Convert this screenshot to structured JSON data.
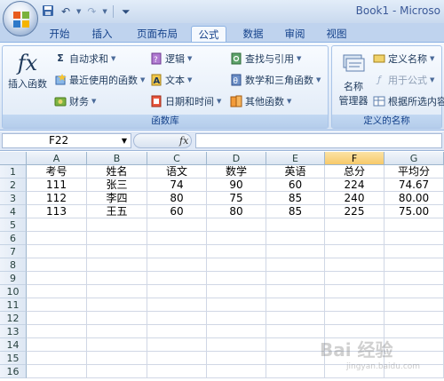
{
  "window": {
    "title": "Book1 - Microso"
  },
  "quick_access": [
    "save-icon",
    "undo-icon",
    "redo-icon",
    "customize-icon"
  ],
  "tabs": [
    {
      "label": "开始"
    },
    {
      "label": "插入"
    },
    {
      "label": "页面布局"
    },
    {
      "label": "公式",
      "active": true
    },
    {
      "label": "数据"
    },
    {
      "label": "审阅"
    },
    {
      "label": "视图"
    }
  ],
  "ribbon": {
    "function_library": {
      "group_label": "函数库",
      "insert_function": "插入函数",
      "autosum": "自动求和",
      "recent": "最近使用的函数",
      "financial": "财务",
      "logical": "逻辑",
      "text": "文本",
      "datetime": "日期和时间",
      "lookup": "查找与引用",
      "math": "数学和三角函数",
      "more": "其他函数"
    },
    "defined_names": {
      "group_label": "定义的名称",
      "name_manager_line1": "名称",
      "name_manager_line2": "管理器",
      "define_name": "定义名称",
      "use_in_formula": "用于公式",
      "create_from_selection": "根据所选内容"
    }
  },
  "formula_bar": {
    "name_box": "F22",
    "fx": "fx",
    "formula": ""
  },
  "sheet": {
    "columns": [
      "A",
      "B",
      "C",
      "D",
      "E",
      "F",
      "G"
    ],
    "selected_column": "F",
    "rows": [
      [
        "考号",
        "姓名",
        "语文",
        "数学",
        "英语",
        "总分",
        "平均分"
      ],
      [
        "111",
        "张三",
        "74",
        "90",
        "60",
        "224",
        "74.67"
      ],
      [
        "112",
        "李四",
        "80",
        "75",
        "85",
        "240",
        "80.00"
      ],
      [
        "113",
        "王五",
        "60",
        "80",
        "85",
        "225",
        "75.00"
      ],
      [
        "",
        "",
        "",
        "",
        "",
        "",
        ""
      ],
      [
        "",
        "",
        "",
        "",
        "",
        "",
        ""
      ],
      [
        "",
        "",
        "",
        "",
        "",
        "",
        ""
      ],
      [
        "",
        "",
        "",
        "",
        "",
        "",
        ""
      ],
      [
        "",
        "",
        "",
        "",
        "",
        "",
        ""
      ],
      [
        "",
        "",
        "",
        "",
        "",
        "",
        ""
      ],
      [
        "",
        "",
        "",
        "",
        "",
        "",
        ""
      ],
      [
        "",
        "",
        "",
        "",
        "",
        "",
        ""
      ],
      [
        "",
        "",
        "",
        "",
        "",
        "",
        ""
      ],
      [
        "",
        "",
        "",
        "",
        "",
        "",
        ""
      ],
      [
        "",
        "",
        "",
        "",
        "",
        "",
        ""
      ],
      [
        "",
        "",
        "",
        "",
        "",
        "",
        ""
      ]
    ],
    "row_numbers": [
      "1",
      "2",
      "3",
      "4",
      "5",
      "6",
      "7",
      "8",
      "9",
      "10",
      "11",
      "12",
      "13",
      "14",
      "15",
      "16"
    ]
  },
  "watermark": {
    "text": "Bai 经验",
    "sub": "jingyan.baidu.com"
  }
}
